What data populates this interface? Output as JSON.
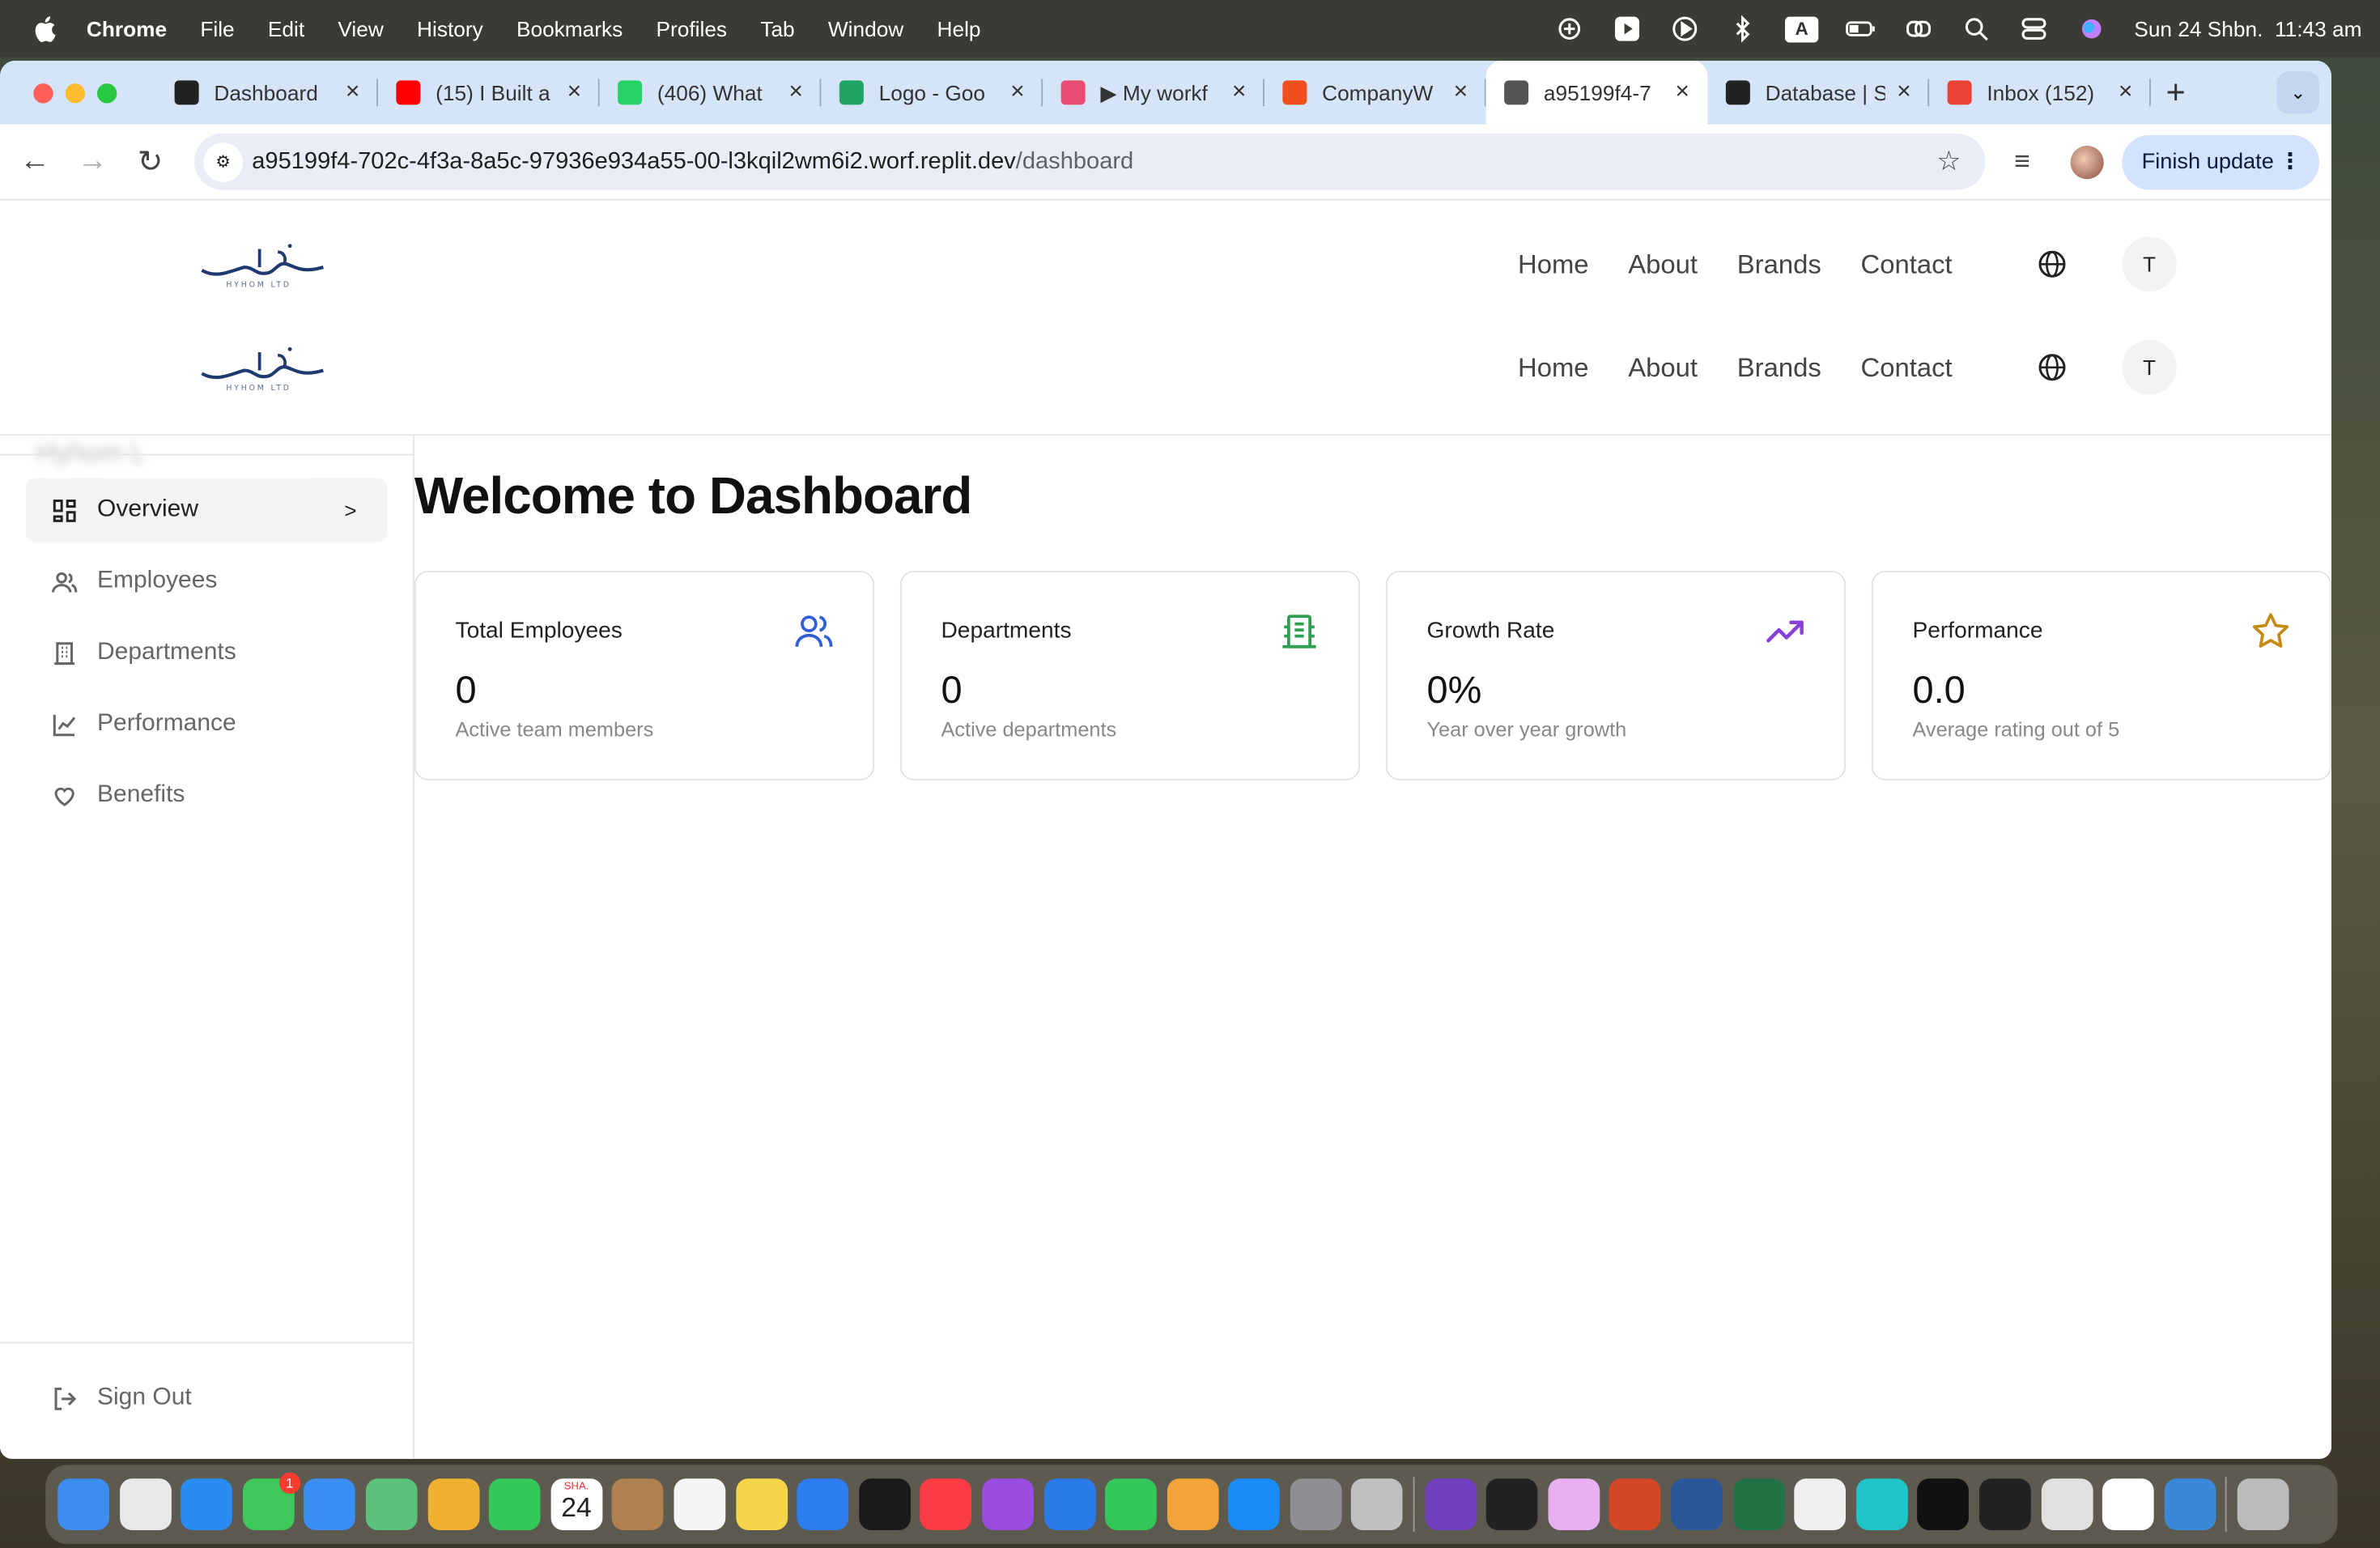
{
  "menubar": {
    "app": "Chrome",
    "items": [
      "File",
      "Edit",
      "View",
      "History",
      "Bookmarks",
      "Profiles",
      "Tab",
      "Window",
      "Help"
    ],
    "akey": "A",
    "datetime": "Sun 24 Shbn.  11:43 am"
  },
  "tabs": [
    {
      "title": "Dashboard",
      "icon": "framer-icon",
      "color": "#222222"
    },
    {
      "title": "(15) I Built a",
      "icon": "youtube-icon",
      "color": "#ff0000"
    },
    {
      "title": "(406) What",
      "icon": "whatsapp-icon",
      "color": "#25d366"
    },
    {
      "title": "Logo - Goo",
      "icon": "google-drive-icon",
      "color": "#1fa463"
    },
    {
      "title": "▶ My workf",
      "icon": "workflow-icon",
      "color": "#ea4b71"
    },
    {
      "title": "CompanyW",
      "icon": "figma-icon",
      "color": "#f24e1e"
    },
    {
      "title": "a95199f4-7",
      "icon": "globe-icon",
      "color": "#555555",
      "active": true
    },
    {
      "title": "Database | S",
      "icon": "supabase-icon",
      "color": "#222222"
    },
    {
      "title": "Inbox (152)",
      "icon": "gmail-icon",
      "color": "#ea4335"
    }
  ],
  "omnibox": {
    "host": "a95199f4-702c-4f3a-8a5c-97936e934a55-00-l3kqil2wm6i2.worf.replit.dev",
    "path": "/dashboard"
  },
  "finish_update": "Finish update",
  "header": {
    "nav": [
      "Home",
      "About",
      "Brands",
      "Contact"
    ],
    "user_initial": "T"
  },
  "blurred_text": "Hyhom L",
  "sidebar": {
    "items": [
      {
        "label": "Overview",
        "icon": "grid-icon",
        "active": true
      },
      {
        "label": "Employees",
        "icon": "users-icon"
      },
      {
        "label": "Departments",
        "icon": "building-icon"
      },
      {
        "label": "Performance",
        "icon": "chart-icon"
      },
      {
        "label": "Benefits",
        "icon": "heart-icon"
      }
    ],
    "signout": "Sign Out"
  },
  "main": {
    "title": "Welcome to Dashboard",
    "cards": [
      {
        "title": "Total Employees",
        "value": "0",
        "subtitle": "Active team members",
        "icon": "users-icon",
        "color": "#2f5fd8"
      },
      {
        "title": "Departments",
        "value": "0",
        "subtitle": "Active departments",
        "icon": "building-icon",
        "color": "#2e9e4f"
      },
      {
        "title": "Growth Rate",
        "value": "0%",
        "subtitle": "Year over year growth",
        "icon": "trending-up-icon",
        "color": "#8b3fd9"
      },
      {
        "title": "Performance",
        "value": "0.0",
        "subtitle": "Average rating out of 5",
        "icon": "star-icon",
        "color": "#c58a12"
      }
    ]
  },
  "dock": {
    "messages_badge": "1",
    "calendar_month": "SHA.",
    "calendar_day": "24",
    "apps": [
      "finder",
      "launchpad",
      "safari",
      "messages",
      "mail",
      "maps",
      "photos",
      "facetime",
      "calendar",
      "contacts",
      "reminders",
      "notes",
      "freeform",
      "tv",
      "music",
      "podcasts",
      "keynote",
      "numbers",
      "pages",
      "app-store",
      "system-settings",
      "iphone-mirroring",
      "perplexity",
      "piano",
      "pixelmator",
      "powerpoint",
      "word",
      "excel",
      "google-play",
      "canva",
      "capcut",
      "terminal",
      "chrome",
      "chatgpt",
      "xcode-tools",
      "trash"
    ]
  }
}
